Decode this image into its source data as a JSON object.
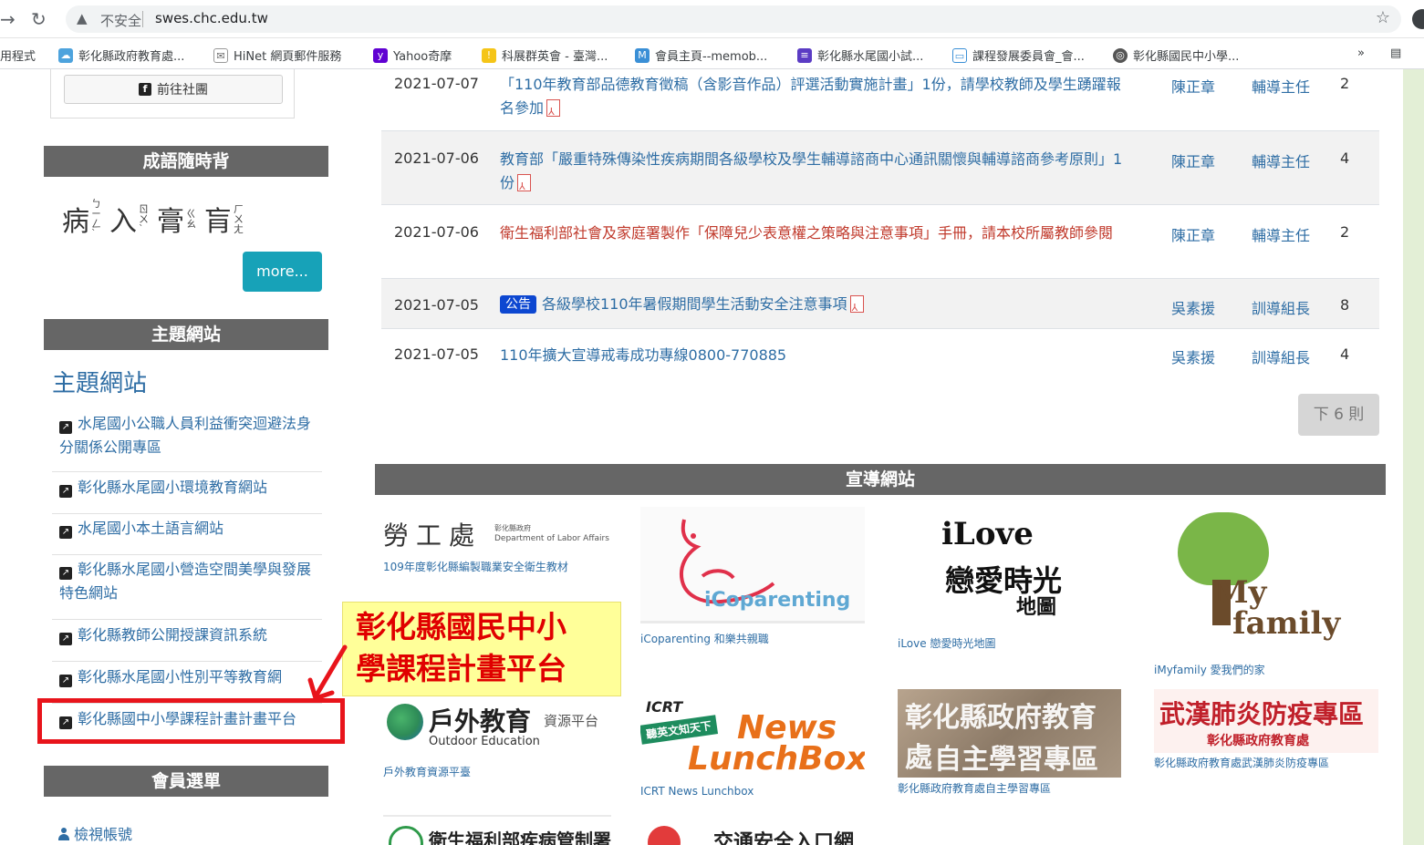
{
  "browser": {
    "insecure_label": "不安全",
    "url": "swes.chc.edu.tw",
    "bookmarks": [
      {
        "label": "用程式"
      },
      {
        "label": "彰化縣政府教育處..."
      },
      {
        "label": "HiNet 網頁郵件服務"
      },
      {
        "label": "Yahoo奇摩"
      },
      {
        "label": "科展群英會 - 臺灣..."
      },
      {
        "label": "會員主頁--memob..."
      },
      {
        "label": "彰化縣水尾國小試..."
      },
      {
        "label": "課程發展委員會_會..."
      },
      {
        "label": "彰化縣國民中小學..."
      }
    ],
    "bookmarks_overflow": "»"
  },
  "sidebar": {
    "fb_button": "前往社團",
    "idiom_header": "成語隨時背",
    "idiom_text": {
      "c1": "病",
      "z1": "ㄅㄧㄥˋ",
      "c2": "入",
      "z2": "ㄖㄨˋ",
      "c3": "膏",
      "z3": "ㄍㄠ",
      "c4": "肓",
      "z4": "ㄏㄨㄤ"
    },
    "more_button": "more...",
    "theme_header": "主題網站",
    "theme_title": "主題網站",
    "links": [
      "水尾國小公職人員利益衝突迴避法身分關係公開專區",
      "彰化縣水尾國小環境教育網站",
      "水尾國小本土語言網站",
      "彰化縣水尾國小營造空間美學與發展特色網站",
      "彰化縣教師公開授課資訊系統",
      "彰化縣水尾國小性別平等教育網",
      "彰化縣國中小學課程計畫計畫平台"
    ],
    "member_header": "會員選單",
    "member_link": "檢視帳號"
  },
  "annotation": {
    "line1": "彰化縣國民中小",
    "line2": "學課程計畫平台"
  },
  "news": [
    {
      "date": "2021-07-07",
      "title": "「110年教育部品德教育徵稿（含影音作品）評選活動實施計畫」1份，請學校教師及學生踴躍報名參加",
      "author": "陳正章",
      "role": "輔導主任",
      "count": "2"
    },
    {
      "date": "2021-07-06",
      "title": "教育部「嚴重特殊傳染性疾病期間各級學校及學生輔導諮商中心通訊關懷與輔導諮商參考原則」1份",
      "author": "陳正章",
      "role": "輔導主任",
      "count": "4"
    },
    {
      "date": "2021-07-06",
      "title": "衛生福利部社會及家庭署製作「保障兒少表意權之策略與注意事項」手冊，請本校所屬教師參閱",
      "author": "陳正章",
      "role": "輔導主任",
      "count": "2"
    },
    {
      "date": "2021-07-05",
      "badge": "公告",
      "title": "各級學校110年暑假期間學生活動安全注意事項",
      "author": "吳素援",
      "role": "訓導組長",
      "count": "8"
    },
    {
      "date": "2021-07-05",
      "title": "110年擴大宣導戒毒成功專線0800-770885",
      "author": "吳素援",
      "role": "訓導組長",
      "count": "4"
    }
  ],
  "next_button": "下 6 則",
  "promo": {
    "header": "宣導網站",
    "labor": {
      "big": "勞工處",
      "small1": "彰化縣政府",
      "small2": "Department of Labor Affairs",
      "caption": "109年度彰化縣編製職業安全衛生教材"
    },
    "coparenting": {
      "logo": "iCoparenting",
      "caption": "iCoparenting 和樂共親職"
    },
    "ilove": {
      "l1": "iLove",
      "l2": "戀愛時光",
      "l3": "地圖",
      "caption": "iLove 戀愛時光地圖"
    },
    "myfamily": {
      "l1": "My",
      "l2": "family",
      "caption": "iMyfamily 愛我們的家"
    },
    "outdoor": {
      "l1": "戶外教育",
      "l1s": "資源平台",
      "l2": "Outdoor Education",
      "caption": "戶外教育資源平臺"
    },
    "lunchbox": {
      "icrt": "ICRT",
      "tag": "聽英文知天下",
      "l1": "News",
      "l2": "LunchBox",
      "caption": "ICRT News Lunchbox"
    },
    "selfstudy": {
      "l1": "彰化縣政府教育處",
      "l2": "自主學習專區",
      "caption": "彰化縣政府教育處自主學習專區"
    },
    "covid": {
      "l1": "武漢肺炎防疫專區",
      "l2": "彰化縣政府教育處",
      "caption": "彰化縣政府教育處武漢肺炎防疫專區"
    },
    "cdc": {
      "l1": "衛生福利部疾病管制署"
    },
    "traffic": {
      "l1": "交通安全入口網"
    }
  },
  "colors": {
    "link_blue": "#2e6da4",
    "header_gray": "#666666",
    "annotation_red": "#e8141b",
    "annotation_bg": "#ffff99",
    "badge_blue": "#0d47d1",
    "more_teal": "#17a2b8"
  }
}
